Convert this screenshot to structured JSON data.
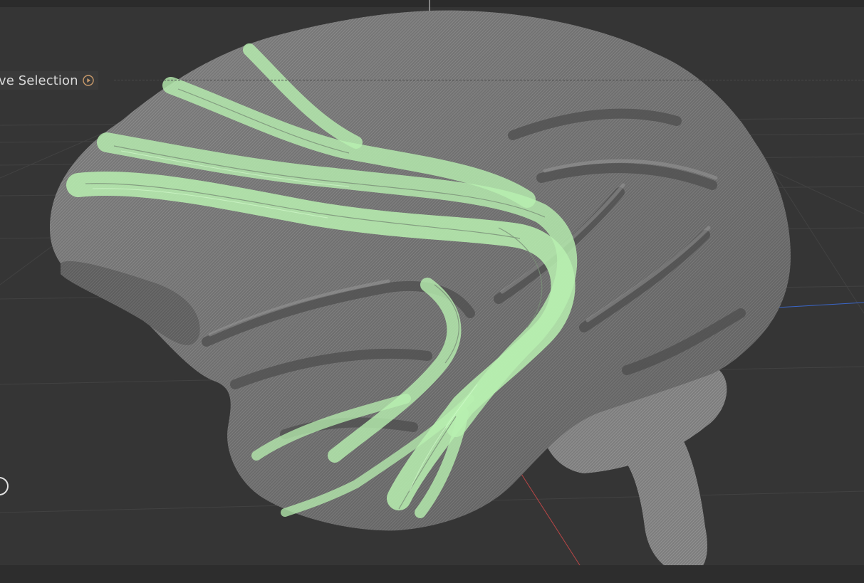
{
  "viewport": {
    "background": "#353535",
    "grid_color": "#404040",
    "axis_colors": {
      "x": "#b04040",
      "y": "#d8d8d8",
      "z": "#3060c0"
    }
  },
  "model": {
    "surface_color": "#8a8a8a",
    "fiber_color": "#b8f0b0"
  },
  "toolbar": {
    "selection_label": "ve Selection",
    "selection_icon": "play-circle-icon"
  },
  "navigation": {
    "icon": "orbit-ring-icon"
  }
}
